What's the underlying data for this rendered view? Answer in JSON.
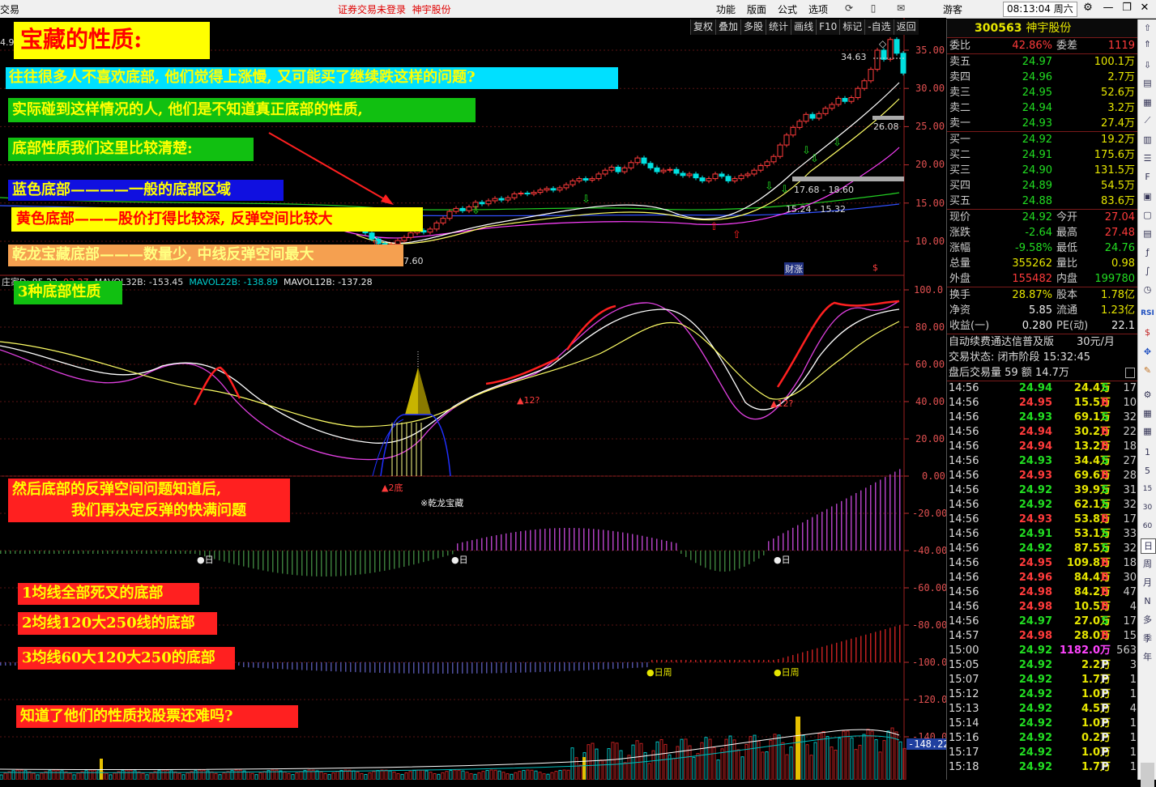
{
  "titlebar": {
    "app_title": "交易",
    "notice": "证券交易未登录",
    "stock_name": "神宇股份",
    "menus": [
      "功能",
      "版面",
      "公式",
      "选项"
    ],
    "user": "游客",
    "clock": "08:13:04 周六"
  },
  "chart_toolbar": [
    "复权",
    "叠加",
    "多股",
    "统计",
    "画线",
    "F10",
    "标记",
    "-自选",
    "返回"
  ],
  "price_axis": [
    "35.00",
    "30.00",
    "25.00",
    "20.00",
    "15.00",
    "10.00"
  ],
  "indicator_axis": [
    "100.0",
    "80.00",
    "60.00",
    "40.00",
    "20.00",
    "0.00",
    "-20.00",
    "-40.00",
    "-60.00",
    "-80.00",
    "-100.0",
    "-120.0",
    "-140.0"
  ],
  "current_value_tag": "-148.22",
  "chart_labels": {
    "high": "34.63",
    "level_1": "26.08",
    "range_1": "17.68 - 18.60",
    "range_2": "15.24 - 15.32",
    "low": "7.60",
    "caizhang": "财涨",
    "dollar": "$",
    "left_cut": "4.9"
  },
  "indicator_header": {
    "name": "庄家D: 85.22",
    "v1": "93.27",
    "mavol32": "MAVOL32B: -153.45",
    "mavol22": "MAVOL22B: -138.89",
    "mavol12": "MAVOL12B: -137.28"
  },
  "indicator_marks": {
    "twelve_a": "▲12?",
    "twelve_b": "▲12?",
    "two_bottom": "▲2底",
    "qianlong": "※乾龙宝藏",
    "day_1": "●日",
    "day_2": "●日",
    "day_3": "●日",
    "dayweek_1": "●日周",
    "dayweek_2": "●日周"
  },
  "annotations": {
    "title": "宝藏的性质:",
    "line1": "往往很多人不喜欢底部, 他们觉得上涨慢, 又可能买了继续跌这样的问题?",
    "line2": "实际碰到这样情况的人, 他们是不知道真正底部的性质,",
    "line3": "底部性质我们这里比较清楚:",
    "blue": "蓝色底部————一般的底部区域",
    "yellow": "黄色底部———股价打得比较深, 反弹空间比较大",
    "orange": "乾龙宝藏底部———数量少, 中线反弹空间最大",
    "three": "3种底部性质",
    "then_a": "然后底部的反弹空间问题知道后,",
    "then_b": "我们再决定反弹的快满问题",
    "b1": "1均线全部死叉的底部",
    "b2": "2均线120大250线的底部",
    "b3": "3均线60大120大250的底部",
    "final": "知道了他们的性质找股票还难吗?"
  },
  "quote": {
    "code": "300563",
    "name": "神宇股份",
    "weibi_label": "委比",
    "weibi": "42.86%",
    "weicha_label": "委差",
    "weicha": "1119",
    "asks": [
      {
        "label": "卖五",
        "price": "24.97",
        "vol": "100.1万"
      },
      {
        "label": "卖四",
        "price": "24.96",
        "vol": "2.7万"
      },
      {
        "label": "卖三",
        "price": "24.95",
        "vol": "52.6万"
      },
      {
        "label": "卖二",
        "price": "24.94",
        "vol": "3.2万"
      },
      {
        "label": "卖一",
        "price": "24.93",
        "vol": "27.4万"
      }
    ],
    "bids": [
      {
        "label": "买一",
        "price": "24.92",
        "vol": "19.2万"
      },
      {
        "label": "买二",
        "price": "24.91",
        "vol": "175.6万"
      },
      {
        "label": "买三",
        "price": "24.90",
        "vol": "131.5万"
      },
      {
        "label": "买四",
        "price": "24.89",
        "vol": "54.5万"
      },
      {
        "label": "买五",
        "price": "24.88",
        "vol": "83.6万"
      }
    ],
    "stats": [
      {
        "l1": "现价",
        "v1": "24.92",
        "l2": "今开",
        "v2": "27.04"
      },
      {
        "l1": "涨跌",
        "v1": "-2.64",
        "l2": "最高",
        "v2": "27.48"
      },
      {
        "l1": "涨幅",
        "v1": "-9.58%",
        "l2": "最低",
        "v2": "24.76"
      },
      {
        "l1": "总量",
        "v1": "355262",
        "l2": "量比",
        "v2": "0.98"
      },
      {
        "l1": "外盘",
        "v1": "155482",
        "l2": "内盘",
        "v2": "199780"
      }
    ],
    "stats2": [
      {
        "l1": "换手",
        "v1": "28.87%",
        "l2": "股本",
        "v2": "1.78亿"
      },
      {
        "l1": "净资",
        "v1": "5.85",
        "l2": "流通",
        "v2": "1.23亿"
      },
      {
        "l1": "收益(一)",
        "v1": "0.280",
        "l2": "PE(动)",
        "v2": "22.1"
      }
    ],
    "service": "自动续费通达信普及版",
    "service_price": "30元/月",
    "trade_state": "交易状态: 闭市阶段 15:32:45",
    "after_hours": "盘后交易量 59 额 14.7万"
  },
  "ticks": [
    {
      "t": "14:56",
      "p": "24.94",
      "v": "24.4万",
      "f": "S",
      "n": "17"
    },
    {
      "t": "14:56",
      "p": "24.95",
      "v": "15.5万",
      "f": "B",
      "n": "10"
    },
    {
      "t": "14:56",
      "p": "24.93",
      "v": "69.1万",
      "f": "S",
      "n": "32"
    },
    {
      "t": "14:56",
      "p": "24.94",
      "v": "30.2万",
      "f": "B",
      "n": "22"
    },
    {
      "t": "14:56",
      "p": "24.94",
      "v": "13.2万",
      "f": "B",
      "n": "18"
    },
    {
      "t": "14:56",
      "p": "24.93",
      "v": "34.4万",
      "f": "S",
      "n": "27"
    },
    {
      "t": "14:56",
      "p": "24.93",
      "v": "69.6万",
      "f": "B",
      "n": "28"
    },
    {
      "t": "14:56",
      "p": "24.92",
      "v": "39.9万",
      "f": "S",
      "n": "31"
    },
    {
      "t": "14:56",
      "p": "24.92",
      "v": "62.1万",
      "f": "S",
      "n": "32"
    },
    {
      "t": "14:56",
      "p": "24.93",
      "v": "53.8万",
      "f": "B",
      "n": "17"
    },
    {
      "t": "14:56",
      "p": "24.91",
      "v": "53.1万",
      "f": "S",
      "n": "33"
    },
    {
      "t": "14:56",
      "p": "24.92",
      "v": "87.5万",
      "f": "S",
      "n": "32"
    },
    {
      "t": "14:56",
      "p": "24.95",
      "v": "109.8万",
      "f": "B",
      "n": "18"
    },
    {
      "t": "14:56",
      "p": "24.96",
      "v": "84.4万",
      "f": "B",
      "n": "30"
    },
    {
      "t": "14:56",
      "p": "24.98",
      "v": "84.2万",
      "f": "B",
      "n": "47"
    },
    {
      "t": "14:56",
      "p": "24.98",
      "v": "10.5万",
      "f": "B",
      "n": "4"
    },
    {
      "t": "14:56",
      "p": "24.97",
      "v": "27.0万",
      "f": "S",
      "n": "17"
    },
    {
      "t": "14:57",
      "p": "24.98",
      "v": "28.0万",
      "f": "B",
      "n": "15"
    },
    {
      "t": "15:00",
      "p": "24.92",
      "v": "1182.0万",
      "f": "",
      "n": "563"
    },
    {
      "t": "15:05",
      "p": "24.92",
      "v": "2.2万",
      "f": "P",
      "n": "3"
    },
    {
      "t": "15:07",
      "p": "24.92",
      "v": "1.7万",
      "f": "P",
      "n": "1"
    },
    {
      "t": "15:12",
      "p": "24.92",
      "v": "1.0万",
      "f": "P",
      "n": "1"
    },
    {
      "t": "15:13",
      "p": "24.92",
      "v": "4.5万",
      "f": "P",
      "n": "4"
    },
    {
      "t": "15:14",
      "p": "24.92",
      "v": "1.0万",
      "f": "P",
      "n": "1"
    },
    {
      "t": "15:16",
      "p": "24.92",
      "v": "0.2万",
      "f": "P",
      "n": "1"
    },
    {
      "t": "15:17",
      "p": "24.92",
      "v": "1.0万",
      "f": "P",
      "n": "1"
    },
    {
      "t": "15:18",
      "p": "24.92",
      "v": "1.7万",
      "f": "P",
      "n": "1"
    }
  ],
  "right_toolbar": [
    "1",
    "5",
    "15",
    "30",
    "60",
    "日",
    "周",
    "月",
    "N",
    "多",
    "季",
    "年",
    "RSI"
  ],
  "colors": {
    "up": "#ff3b3b",
    "down": "#22dd22",
    "accent_yellow": "#e6e600",
    "ma_white": "#ffffff",
    "ma_yellow": "#ffff66",
    "ma_magenta": "#ff40ff",
    "ma_green": "#22cc22"
  }
}
